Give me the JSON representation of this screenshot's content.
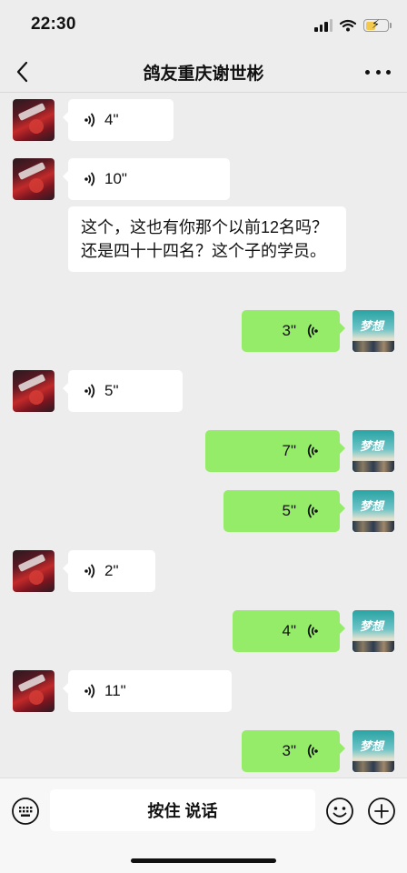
{
  "status": {
    "time": "22:30"
  },
  "header": {
    "title": "鸽友重庆谢世彬"
  },
  "messages": [
    {
      "side": "left",
      "duration": "4\""
    },
    {
      "side": "left",
      "duration": "10\""
    },
    {
      "side": "left",
      "text": "这个，这也有你那个以前12名吗？还是四十十四名？这个子的学员。"
    },
    {
      "side": "right",
      "duration": "3\""
    },
    {
      "side": "left",
      "duration": "5\""
    },
    {
      "side": "right",
      "duration": "7\""
    },
    {
      "side": "right",
      "duration": "5\""
    },
    {
      "side": "left",
      "duration": "2\""
    },
    {
      "side": "right",
      "duration": "4\""
    },
    {
      "side": "left",
      "duration": "11\""
    },
    {
      "side": "right",
      "duration": "3\""
    }
  ],
  "input_bar": {
    "hold_to_talk_label": "按住 说话"
  },
  "icons": {
    "back": "chevron-left-icon",
    "more": "more-dots-icon",
    "keyboard": "keyboard-icon",
    "emoji": "emoji-icon",
    "plus": "plus-icon",
    "voice": "voice-wave-icon"
  },
  "colors": {
    "background": "#ededed",
    "sent_bubble": "#95ec69",
    "received_bubble": "#ffffff"
  }
}
